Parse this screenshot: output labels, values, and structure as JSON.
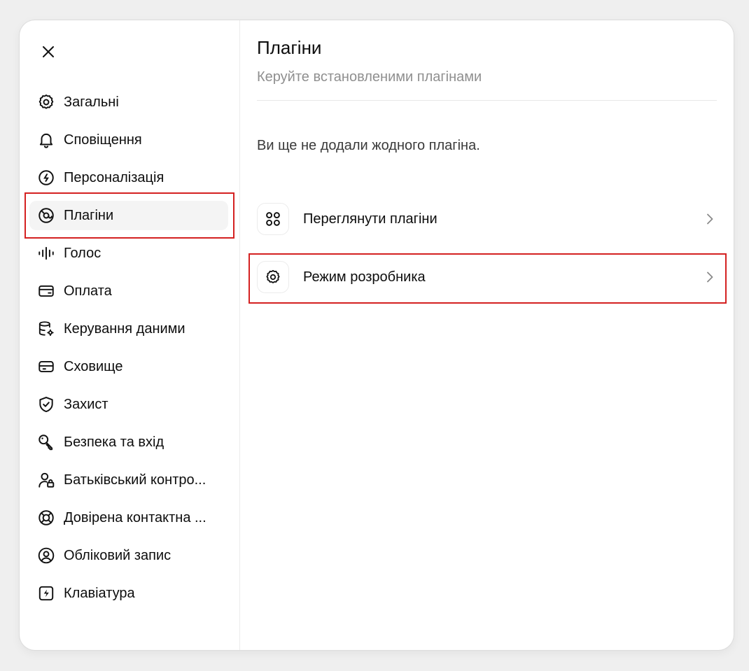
{
  "sidebar": {
    "items": [
      {
        "label": "Загальні",
        "icon": "gear-icon"
      },
      {
        "label": "Сповіщення",
        "icon": "bell-icon"
      },
      {
        "label": "Персоналізація",
        "icon": "personalization-icon"
      },
      {
        "label": "Плагіни",
        "icon": "plugins-icon"
      },
      {
        "label": "Голос",
        "icon": "voice-waveform-icon"
      },
      {
        "label": "Оплата",
        "icon": "credit-card-icon"
      },
      {
        "label": "Керування даними",
        "icon": "database-icon"
      },
      {
        "label": "Сховище",
        "icon": "storage-drive-icon"
      },
      {
        "label": "Захист",
        "icon": "shield-check-icon"
      },
      {
        "label": "Безпека та вхід",
        "icon": "key-icon"
      },
      {
        "label": "Батьківський контро...",
        "icon": "user-lock-icon"
      },
      {
        "label": "Довірена контактна ...",
        "icon": "lifebuoy-icon"
      },
      {
        "label": "Обліковий запис",
        "icon": "user-circle-icon"
      },
      {
        "label": "Клавіатура",
        "icon": "keyboard-shortcut-icon"
      }
    ],
    "active_index": 3
  },
  "main": {
    "title": "Плагіни",
    "subtitle": "Керуйте встановленими плагінами",
    "empty_message": "Ви ще не додали жодного плагіна.",
    "rows": [
      {
        "label": "Переглянути плагіни",
        "icon": "grid-dots-icon"
      },
      {
        "label": "Режим розробника",
        "icon": "gear-icon"
      }
    ]
  },
  "colors": {
    "highlight": "#d42121",
    "subtitle": "#8f8f8f",
    "active_bg": "#f4f4f4"
  }
}
